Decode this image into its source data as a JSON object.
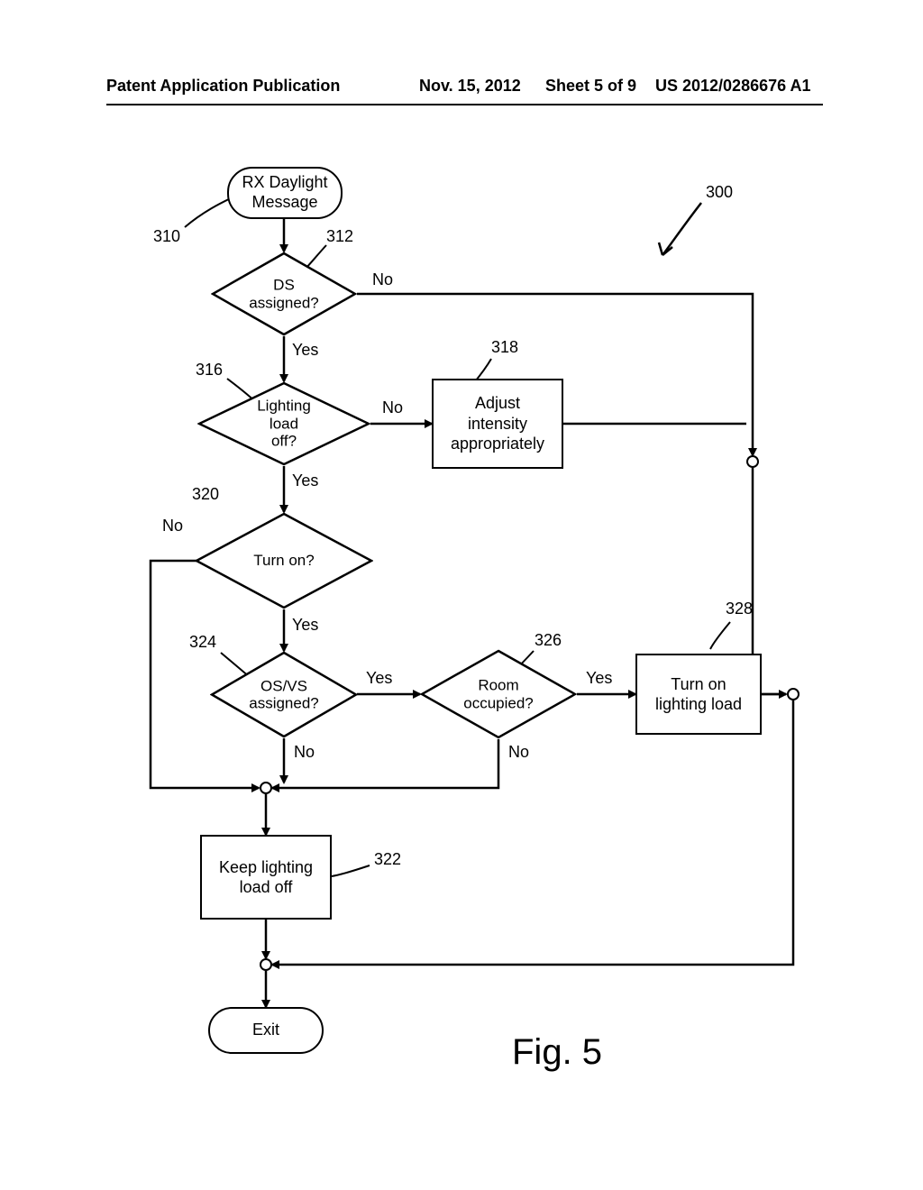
{
  "header": {
    "left": "Patent Application Publication",
    "date": "Nov. 15, 2012",
    "sheet": "Sheet 5 of 9",
    "pubno": "US 2012/0286676 A1"
  },
  "figure": {
    "label": "Fig. 5",
    "ref_main": "300"
  },
  "nodes": {
    "start": "RX Daylight\nMessage",
    "d_ds": "DS\nassigned?",
    "d_off": "Lighting load\noff?",
    "d_turnon": "Turn on?",
    "d_osvs": "OS/VS\nassigned?",
    "d_room": "Room\noccupied?",
    "p_adjust": "Adjust\nintensity\nappropriately",
    "p_turnon": "Turn on\nlighting load",
    "p_keepoff": "Keep lighting\nload off",
    "exit": "Exit"
  },
  "branch": {
    "yes": "Yes",
    "no": "No"
  },
  "refs": {
    "r310": "310",
    "r312": "312",
    "r316": "316",
    "r318": "318",
    "r320": "320",
    "r322": "322",
    "r324": "324",
    "r326": "326",
    "r328": "328"
  }
}
